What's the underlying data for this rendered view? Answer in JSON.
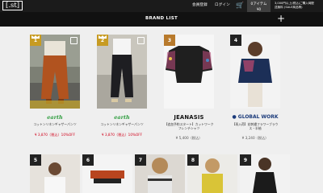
{
  "header": {
    "logo": "[.st]",
    "links": [
      "会員登録",
      "ログイン"
    ],
    "cart_label": "0アイテム",
    "cart_sub": "¥0",
    "shipping_line1": "3,000円以上(税込)ご購入時配",
    "shipping_line2": "送無料 (SALE商品等)"
  },
  "brandbar": {
    "title": "BRAND LIST",
    "add_icon": "plus-icon"
  },
  "colors": {
    "topbar": "#1b1b1b",
    "brandbar": "#111111",
    "sale": "#d0021b",
    "gold": "#c79b22",
    "dark_badge": "#222222",
    "background": "#efefef"
  },
  "products": [
    {
      "rank": "1",
      "brand_logo": "earth",
      "brand": "",
      "name": "コットンリネンギャザーパンツ",
      "brand_sub": "",
      "price": "¥ 3,870（税込）10%OFF",
      "price_type": "sale"
    },
    {
      "rank": "2",
      "brand_logo": "earth",
      "brand": "",
      "name": "コットンリネンギャザーパンツ",
      "brand_sub": "",
      "price": "¥ 3,870（税込）10%OFF",
      "price_type": "sale"
    },
    {
      "rank": "3",
      "brand_logo": "JEANASIS",
      "brand": "",
      "name": "【追加予約スタート】カットワークフレンチシャツ",
      "brand_sub": "",
      "price": "¥ 5,400（税込）",
      "price_type": "reg"
    },
    {
      "rank": "4",
      "brand_logo": "GLOBAL WORK",
      "brand": "",
      "name": "【再入荷】花刺繍フラワーブラウス・半袖",
      "brand_sub": "",
      "price": "¥ 3,240（税込）",
      "price_type": "reg"
    },
    {
      "rank": "5"
    },
    {
      "rank": "6"
    },
    {
      "rank": "7"
    },
    {
      "rank": "8"
    },
    {
      "rank": "9"
    }
  ]
}
